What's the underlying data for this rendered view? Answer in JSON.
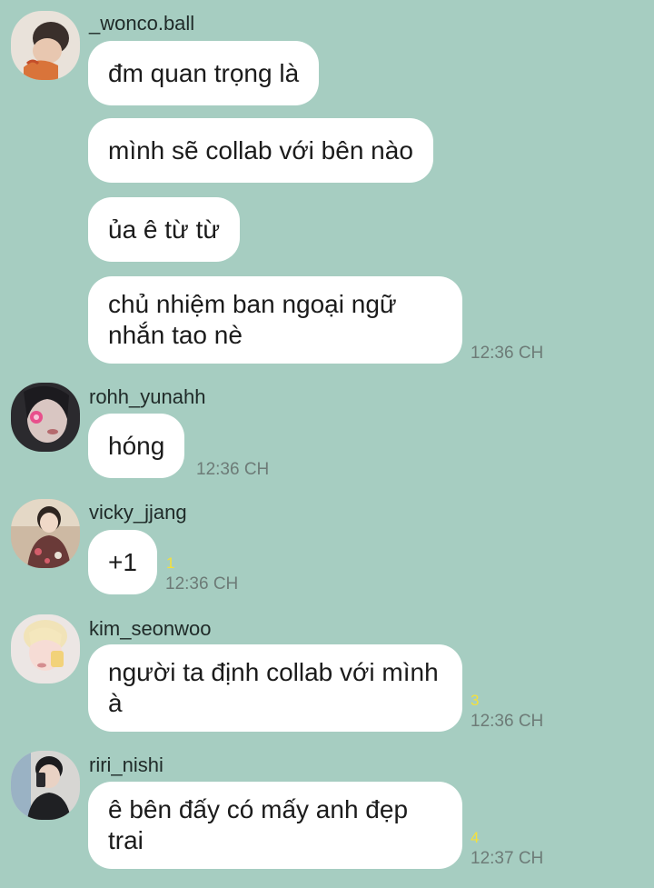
{
  "messages": [
    {
      "sender": "_wonco.ball",
      "bubbles": [
        "đm quan trọng là",
        "mình sẽ collab với bên nào",
        "ủa ê từ từ",
        "chủ nhiệm ban ngoại ngữ nhắn tao nè"
      ],
      "time": "12:36 CH",
      "avatar_icon": "user-avatar-photo"
    },
    {
      "sender": "rohh_yunahh",
      "bubbles": [
        "hóng"
      ],
      "time": "12:36 CH",
      "avatar_icon": "user-avatar-photo"
    },
    {
      "sender": "vicky_jjang",
      "bubbles": [
        "+1"
      ],
      "unread": "1",
      "time": "12:36 CH",
      "avatar_icon": "user-avatar-photo"
    },
    {
      "sender": "kim_seonwoo",
      "bubbles": [
        "người ta định collab với mình à"
      ],
      "unread": "3",
      "time": "12:36 CH",
      "avatar_icon": "user-avatar-photo"
    },
    {
      "sender": "riri_nishi",
      "bubbles": [
        "ê bên đấy có mấy anh đẹp trai"
      ],
      "unread": "4",
      "time": "12:37 CH",
      "avatar_icon": "user-avatar-photo"
    }
  ],
  "colors": {
    "background": "#a6cdc1",
    "bubble": "#ffffff",
    "unread_count": "#f5e03a",
    "timestamp": "#6d7b77"
  }
}
